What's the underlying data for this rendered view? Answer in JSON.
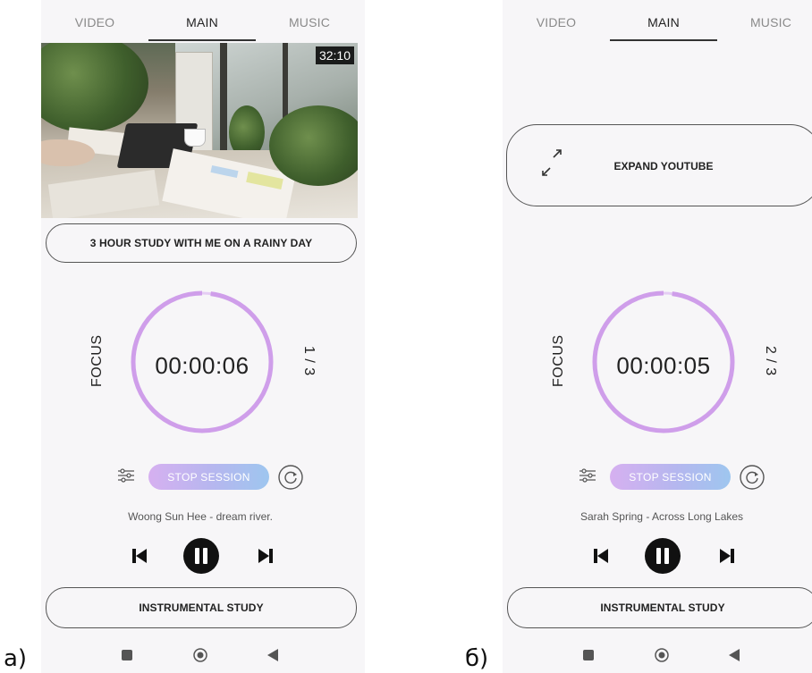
{
  "figure_labels": {
    "a": "a)",
    "b": "б)"
  },
  "screens": [
    {
      "tabs": [
        "VIDEO",
        "MAIN",
        "MUSIC"
      ],
      "active_tab": "MAIN",
      "video": {
        "duration": "32:10"
      },
      "video_title": "3 HOUR STUDY WITH ME ON A RAINY DAY",
      "timer": {
        "time": "00:00:06",
        "mode_label": "FOCUS",
        "session_count": "1 / 3",
        "progress": 0.02
      },
      "stop_label": "STOP SESSION",
      "track_title": "Woong Sun Hee - dream river.",
      "playlist_label": "INSTRUMENTAL STUDY",
      "icons": [
        "settings-icon",
        "reset-icon",
        "previous-icon",
        "pause-icon",
        "next-icon",
        "nav-square-icon",
        "nav-home-icon",
        "nav-back-icon"
      ]
    },
    {
      "tabs": [
        "VIDEO",
        "MAIN",
        "MUSIC"
      ],
      "active_tab": "MAIN",
      "expand_label": "EXPAND YOUTUBE",
      "timer": {
        "time": "00:00:05",
        "mode_label": "FOCUS",
        "session_count": "2 / 3",
        "progress": 0.02
      },
      "stop_label": "STOP SESSION",
      "track_title": "Sarah Spring - Across Long Lakes",
      "playlist_label": "INSTRUMENTAL STUDY",
      "icons": [
        "expand-icon",
        "settings-icon",
        "reset-icon",
        "previous-icon",
        "pause-icon",
        "next-icon",
        "nav-square-icon",
        "nav-home-icon",
        "nav-back-icon"
      ]
    }
  ],
  "colors": {
    "background": "#f7f6f8",
    "ring": "#d4a9ec",
    "stop_gradient_start": "#d6b0f0",
    "stop_gradient_end": "#9ec6ef"
  }
}
